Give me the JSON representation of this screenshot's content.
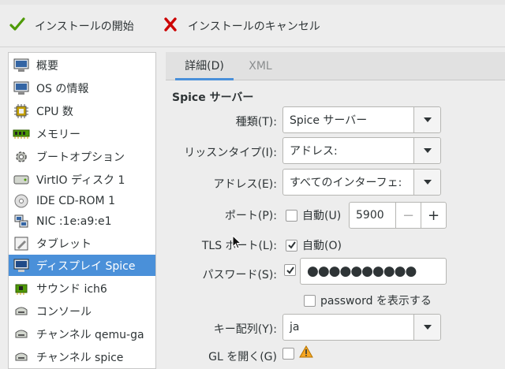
{
  "toolbar": {
    "begin_install_label": "インストールの開始",
    "cancel_install_label": "インストールのキャンセル"
  },
  "sidebar": {
    "items": [
      {
        "label": "概要",
        "icon": "computer-icon"
      },
      {
        "label": "OS の情報",
        "icon": "computer-info-icon"
      },
      {
        "label": "CPU 数",
        "icon": "cpu-icon"
      },
      {
        "label": "メモリー",
        "icon": "memory-icon"
      },
      {
        "label": "ブートオプション",
        "icon": "gear-icon"
      },
      {
        "label": "VirtIO ディスク 1",
        "icon": "hard-disk-icon"
      },
      {
        "label": "IDE CD-ROM 1",
        "icon": "cdrom-icon"
      },
      {
        "label": "NIC :1e:a9:e1",
        "icon": "network-icon"
      },
      {
        "label": "タブレット",
        "icon": "tablet-icon"
      },
      {
        "label": "ディスプレイ Spice",
        "icon": "display-icon"
      },
      {
        "label": "サウンド ich6",
        "icon": "sound-icon"
      },
      {
        "label": "コンソール",
        "icon": "serial-icon"
      },
      {
        "label": "チャンネル qemu-ga",
        "icon": "channel-icon"
      },
      {
        "label": "チャンネル spice",
        "icon": "channel-icon"
      }
    ],
    "selected_index": 9
  },
  "tabs": [
    {
      "label": "詳細(D)",
      "active": true
    },
    {
      "label": "XML",
      "active": false
    }
  ],
  "spice": {
    "section_title": "Spice サーバー",
    "type_label": "種類(T):",
    "type_value": "Spice サーバー",
    "listen_label": "リッスンタイプ(I):",
    "listen_value": "アドレス:",
    "address_label": "アドレス(E):",
    "address_value": "すべてのインターフェ:",
    "port_label": "ポート(P):",
    "port_auto_label": "自動(U)",
    "port_auto_checked": false,
    "port_value": "5900",
    "port_minus": "−",
    "port_plus": "+",
    "tls_label": "TLS ポート(L):",
    "tls_auto_label": "自動(O)",
    "tls_auto_checked": true,
    "password_label": "パスワード(S):",
    "password_checked": true,
    "password_value": "●●●●●●●●●●",
    "show_password_label": "password を表示する",
    "keymap_label": "キー配列(Y):",
    "keymap_value": "ja",
    "opengl_label": "GL を開く(G)",
    "opengl_checked": false
  },
  "colors": {
    "accent": "#4a90d9",
    "check_green": "#4e9a06",
    "cancel_red": "#cc0000",
    "warning": "#f5a623"
  }
}
